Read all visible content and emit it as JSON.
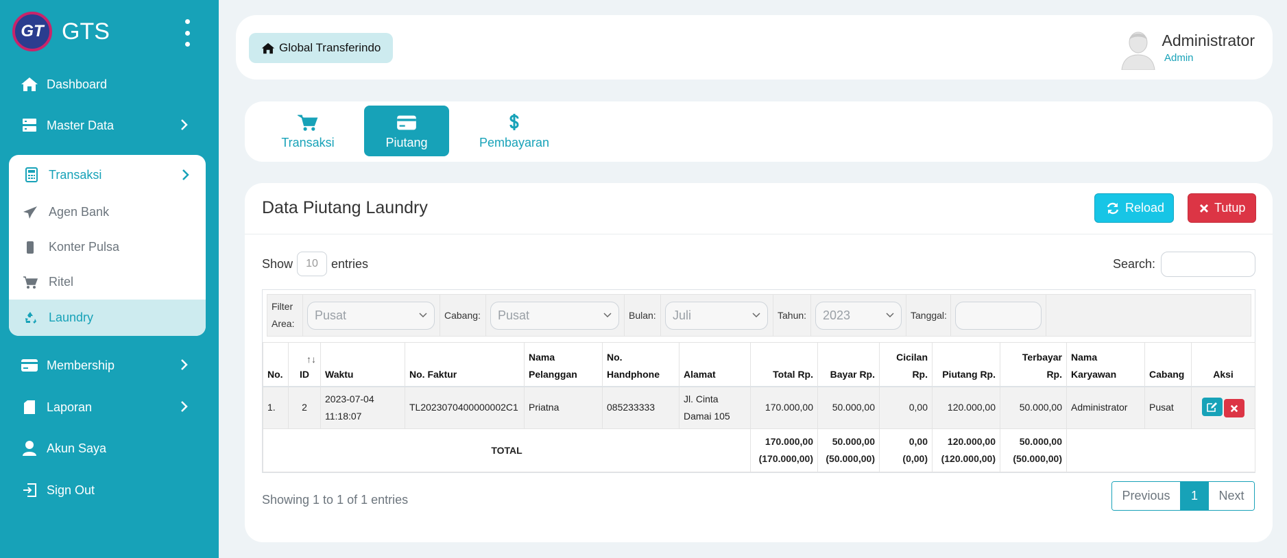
{
  "brand": {
    "name": "GTS",
    "logo_text": "GT"
  },
  "sidebar": {
    "dashboard": "Dashboard",
    "master_data": "Master Data",
    "transaksi": "Transaksi",
    "sub_items": [
      "Agen Bank",
      "Konter Pulsa",
      "Ritel",
      "Laundry"
    ],
    "membership": "Membership",
    "laporan": "Laporan",
    "akun_saya": "Akun Saya",
    "sign_out": "Sign Out"
  },
  "header": {
    "home_label": "Global Transferindo",
    "user_name": "Administrator",
    "user_role": "Admin"
  },
  "tabs": [
    {
      "label": "Transaksi",
      "icon": "cart-icon"
    },
    {
      "label": "Piutang",
      "icon": "credit-card-icon",
      "active": true
    },
    {
      "label": "Pembayaran",
      "icon": "dollar-icon"
    }
  ],
  "card": {
    "title": "Data Piutang Laundry",
    "reload_label": "Reload",
    "close_label": "Tutup"
  },
  "table_controls": {
    "show_label": "Show",
    "entries_value": "10",
    "entries_label": "entries",
    "search_label": "Search:",
    "search_value": ""
  },
  "filters": {
    "area_label_1": "Filter",
    "area_label_2": "Area:",
    "area_value": "Pusat",
    "cabang_label": "Cabang:",
    "cabang_value": "Pusat",
    "bulan_label": "Bulan:",
    "bulan_value": "Juli",
    "tahun_label": "Tahun:",
    "tahun_value": "2023",
    "tanggal_label": "Tanggal:",
    "tanggal_value": ""
  },
  "columns": {
    "no": "No.",
    "id": "ID",
    "waktu": "Waktu",
    "faktur": "No. Faktur",
    "pelanggan_1": "Nama",
    "pelanggan_2": "Pelanggan",
    "hp_1": "No.",
    "hp_2": "Handphone",
    "alamat": "Alamat",
    "total": "Total Rp.",
    "bayar": "Bayar Rp.",
    "cicilan_1": "Cicilan",
    "cicilan_2": "Rp.",
    "piutang": "Piutang Rp.",
    "terbayar_1": "Terbayar",
    "terbayar_2": "Rp.",
    "karyawan_1": "Nama",
    "karyawan_2": "Karyawan",
    "cabang": "Cabang",
    "aksi": "Aksi",
    "sort_symbol": "↑↓"
  },
  "rows": [
    {
      "no": "1.",
      "id": "2",
      "waktu_date": "2023-07-04",
      "waktu_time": "11:18:07",
      "faktur": "TL2023070400000002C1",
      "pelanggan": "Priatna",
      "hp": "085233333",
      "alamat_1": "Jl. Cinta",
      "alamat_2": "Damai 105",
      "total": "170.000,00",
      "bayar": "50.000,00",
      "cicilan": "0,00",
      "piutang": "120.000,00",
      "terbayar": "50.000,00",
      "karyawan": "Administrator",
      "cabang": "Pusat"
    }
  ],
  "totals": {
    "label": "TOTAL",
    "total": "170.000,00",
    "total_all": "(170.000,00)",
    "bayar": "50.000,00",
    "bayar_all": "(50.000,00)",
    "cicilan": "0,00",
    "cicilan_all": "(0,00)",
    "piutang": "120.000,00",
    "piutang_all": "(120.000,00)",
    "terbayar": "50.000,00",
    "terbayar_all": "(50.000,00)"
  },
  "footer": {
    "info": "Showing 1 to 1 of 1 entries",
    "previous": "Previous",
    "page": "1",
    "next": "Next"
  },
  "colors": {
    "accent": "#17a2b8",
    "danger": "#dc3545",
    "info_button": "#17c5e6"
  }
}
